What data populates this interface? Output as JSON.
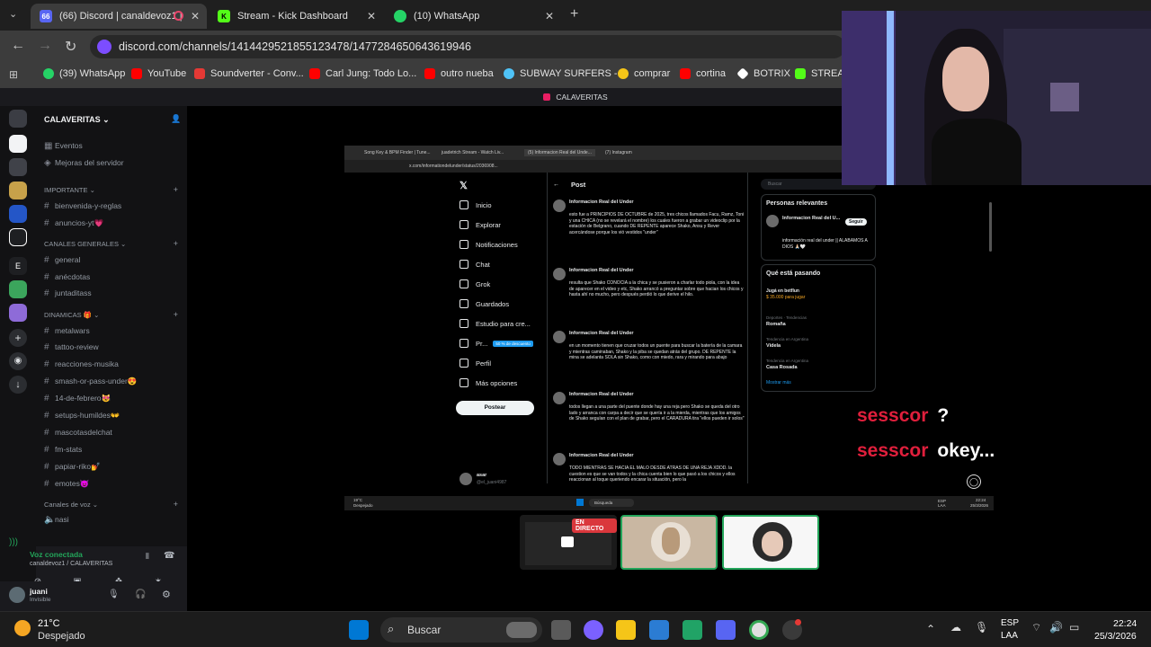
{
  "browser": {
    "tabs": [
      {
        "label": "(66) Discord | canaldevoz1 |",
        "badge": "66",
        "color": "#5865f2",
        "active": true
      },
      {
        "label": "Stream - Kick Dashboard",
        "color": "#53fc18",
        "active": false
      },
      {
        "label": "(10) WhatsApp",
        "color": "#25d366",
        "active": false
      }
    ],
    "url": "discord.com/channels/1414429521855123478/1477284650643619946",
    "bookmarks": [
      {
        "label": "(39) WhatsApp",
        "color": "#25d366"
      },
      {
        "label": "YouTube",
        "color": "#ff0000"
      },
      {
        "label": "Soundverter - Conv...",
        "color": "#e53935"
      },
      {
        "label": "Carl Jung: Todo Lo...",
        "color": "#ff0000"
      },
      {
        "label": "outro nueba",
        "color": "#ff0000"
      },
      {
        "label": "SUBWAY SURFERS -...",
        "color": "#4fc3f7"
      },
      {
        "label": "comprar",
        "color": "#f5c518"
      },
      {
        "label": "cortina",
        "color": "#ff0000"
      },
      {
        "label": "BOTRIX",
        "color": "#ffffff"
      },
      {
        "label": "STREAM",
        "color": "#53fc18"
      }
    ]
  },
  "discord": {
    "top_title": "CALAVERITAS",
    "server_name": "CALAVERITAS",
    "top_items": [
      "Eventos",
      "Mejoras del servidor"
    ],
    "categories": [
      {
        "name": "IMPORTANTE",
        "channels": [
          "bienvenida-y-reglas",
          "anuncios-yt💗"
        ]
      },
      {
        "name": "CANALES GENERALES",
        "channels": [
          "general",
          "anécdotas",
          "juntaditass"
        ]
      },
      {
        "name": "DINAMICAS 🎁",
        "channels": [
          "metalwars",
          "tattoo-review",
          "reacciones-musika",
          "smash-or-pass-under😍",
          "14-de-febrero😻",
          "setups-humildes👐",
          "mascotasdelchat",
          "fm-stats",
          "papiar-riko💅",
          "emotes👿"
        ]
      },
      {
        "name": "Canales de voz",
        "channels": [
          "nasi"
        ]
      }
    ],
    "voice": {
      "status": "Voz conectada",
      "channel": "canaldevoz1 / CALAVERITAS"
    },
    "user": {
      "name": "juani",
      "status": "Invisible"
    },
    "live_badge": "EN DIRECTO"
  },
  "stream": {
    "inner_tabs": [
      "Song Key & BPM Finder | Tune...",
      "juadetrich Stream - Watch Liv...",
      "(5) Informacion Real del Unde...",
      "(7) Instagram"
    ],
    "inner_url": "x.com/informationdelunder/status/2036908...",
    "x_nav": [
      "Inicio",
      "Explorar",
      "Notificaciones",
      "Chat",
      "Grok",
      "Guardados",
      "Estudio para cre...",
      "Pr...",
      "Perfil",
      "Más opciones"
    ],
    "x_nav_promo": "50 % de descuento",
    "post_button": "Postear",
    "post_header": "Post",
    "x_user": "asar",
    "x_user_handle": "@el_juani4987",
    "posts": [
      {
        "author": "Informacion Real del Under",
        "text": "esto fue a PRINCIPIOS DE OCTUBRE de 2025, tres chicos llamados Facu, Ramz, Toni y una CHICA (no se revelará el nombre) los cuales fueron a grabar un videoclip por la estación de Belgrano, cuando DE REPENTE aparece Shako, Ansu y Rever acercándose porque los vió vestidos \"under\""
      },
      {
        "author": "Informacion Real del Under",
        "text": "resulta que Shako CONOCIA a la chica y se pusieron a charlar todo piola, con la idea de aparecer en el video y etc, Shako arrancó a preguntar sobre que hacian los chicos y hasta ahí no mucho, pero después perdió lo que derive el hilo."
      },
      {
        "author": "Informacion Real del Under",
        "text": "en un momento tienen que cruzar todos un puente para buscar la batería de la camara y mientras caminaban, Shako y la piba se quedan atrás del grupo. DE REPENTE la mina se adelanta SOLA sin Shako, como con miedo, rara y mirando para abajo"
      },
      {
        "author": "Informacion Real del Under",
        "text": "todos llegan a una parte del puente donde hay una reja pero Shako se queda del otro lado y arranca con carpa a decir que se quería ir a la mierda, mientras que los amigos de Shako seguían con el plan de grabar, pero el CARADURA tira \"ellos pueden ir solos\""
      },
      {
        "author": "Informacion Real del Under",
        "text": "TODO MIENTRAS SE HACIA EL MALO DESDE ATRAS DE UNA REJA XDDD. la cuestion es que se van todos y la chica cuenta bien lo que pasó a los chicos y ellos reaccionan al toque queriendo encarar la situación, pero la"
      }
    ],
    "relevant_title": "Personas relevantes",
    "relevant_name": "Informacion Real del U...",
    "relevant_follow": "Seguir",
    "relevant_bio": "información real del under || ALABAMOS A DIOS 🙏🏻🤍",
    "trending_title": "Qué está pasando",
    "trending": [
      {
        "top": "Jugá en betflun",
        "sub": "$ 35.000 para jugar"
      },
      {
        "top": "Deportes · Tendencias",
        "sub": "Romaña"
      },
      {
        "top": "Tendencia en Argentina",
        "sub": "Videla"
      },
      {
        "top": "Tendencia en Argentina",
        "sub": "Casa Rosada"
      }
    ],
    "show_more": "Mostrar más",
    "search_placeholder": "Buscar",
    "inner_weather": "19°C",
    "inner_weather_desc": "Despejado",
    "inner_search": "Búsqueda",
    "inner_lang": "ESP LAA",
    "inner_time": "22:24",
    "inner_date": "25/3/2026"
  },
  "chat": [
    {
      "user": "sesscor",
      "message": "?"
    },
    {
      "user": "sesscor",
      "message": "okey..."
    }
  ],
  "taskbar": {
    "weather_temp": "21°C",
    "weather_desc": "Despejado",
    "search_label": "Buscar",
    "lang": "ESP",
    "lang2": "LAA",
    "time": "22:24",
    "date": "25/3/2026"
  }
}
